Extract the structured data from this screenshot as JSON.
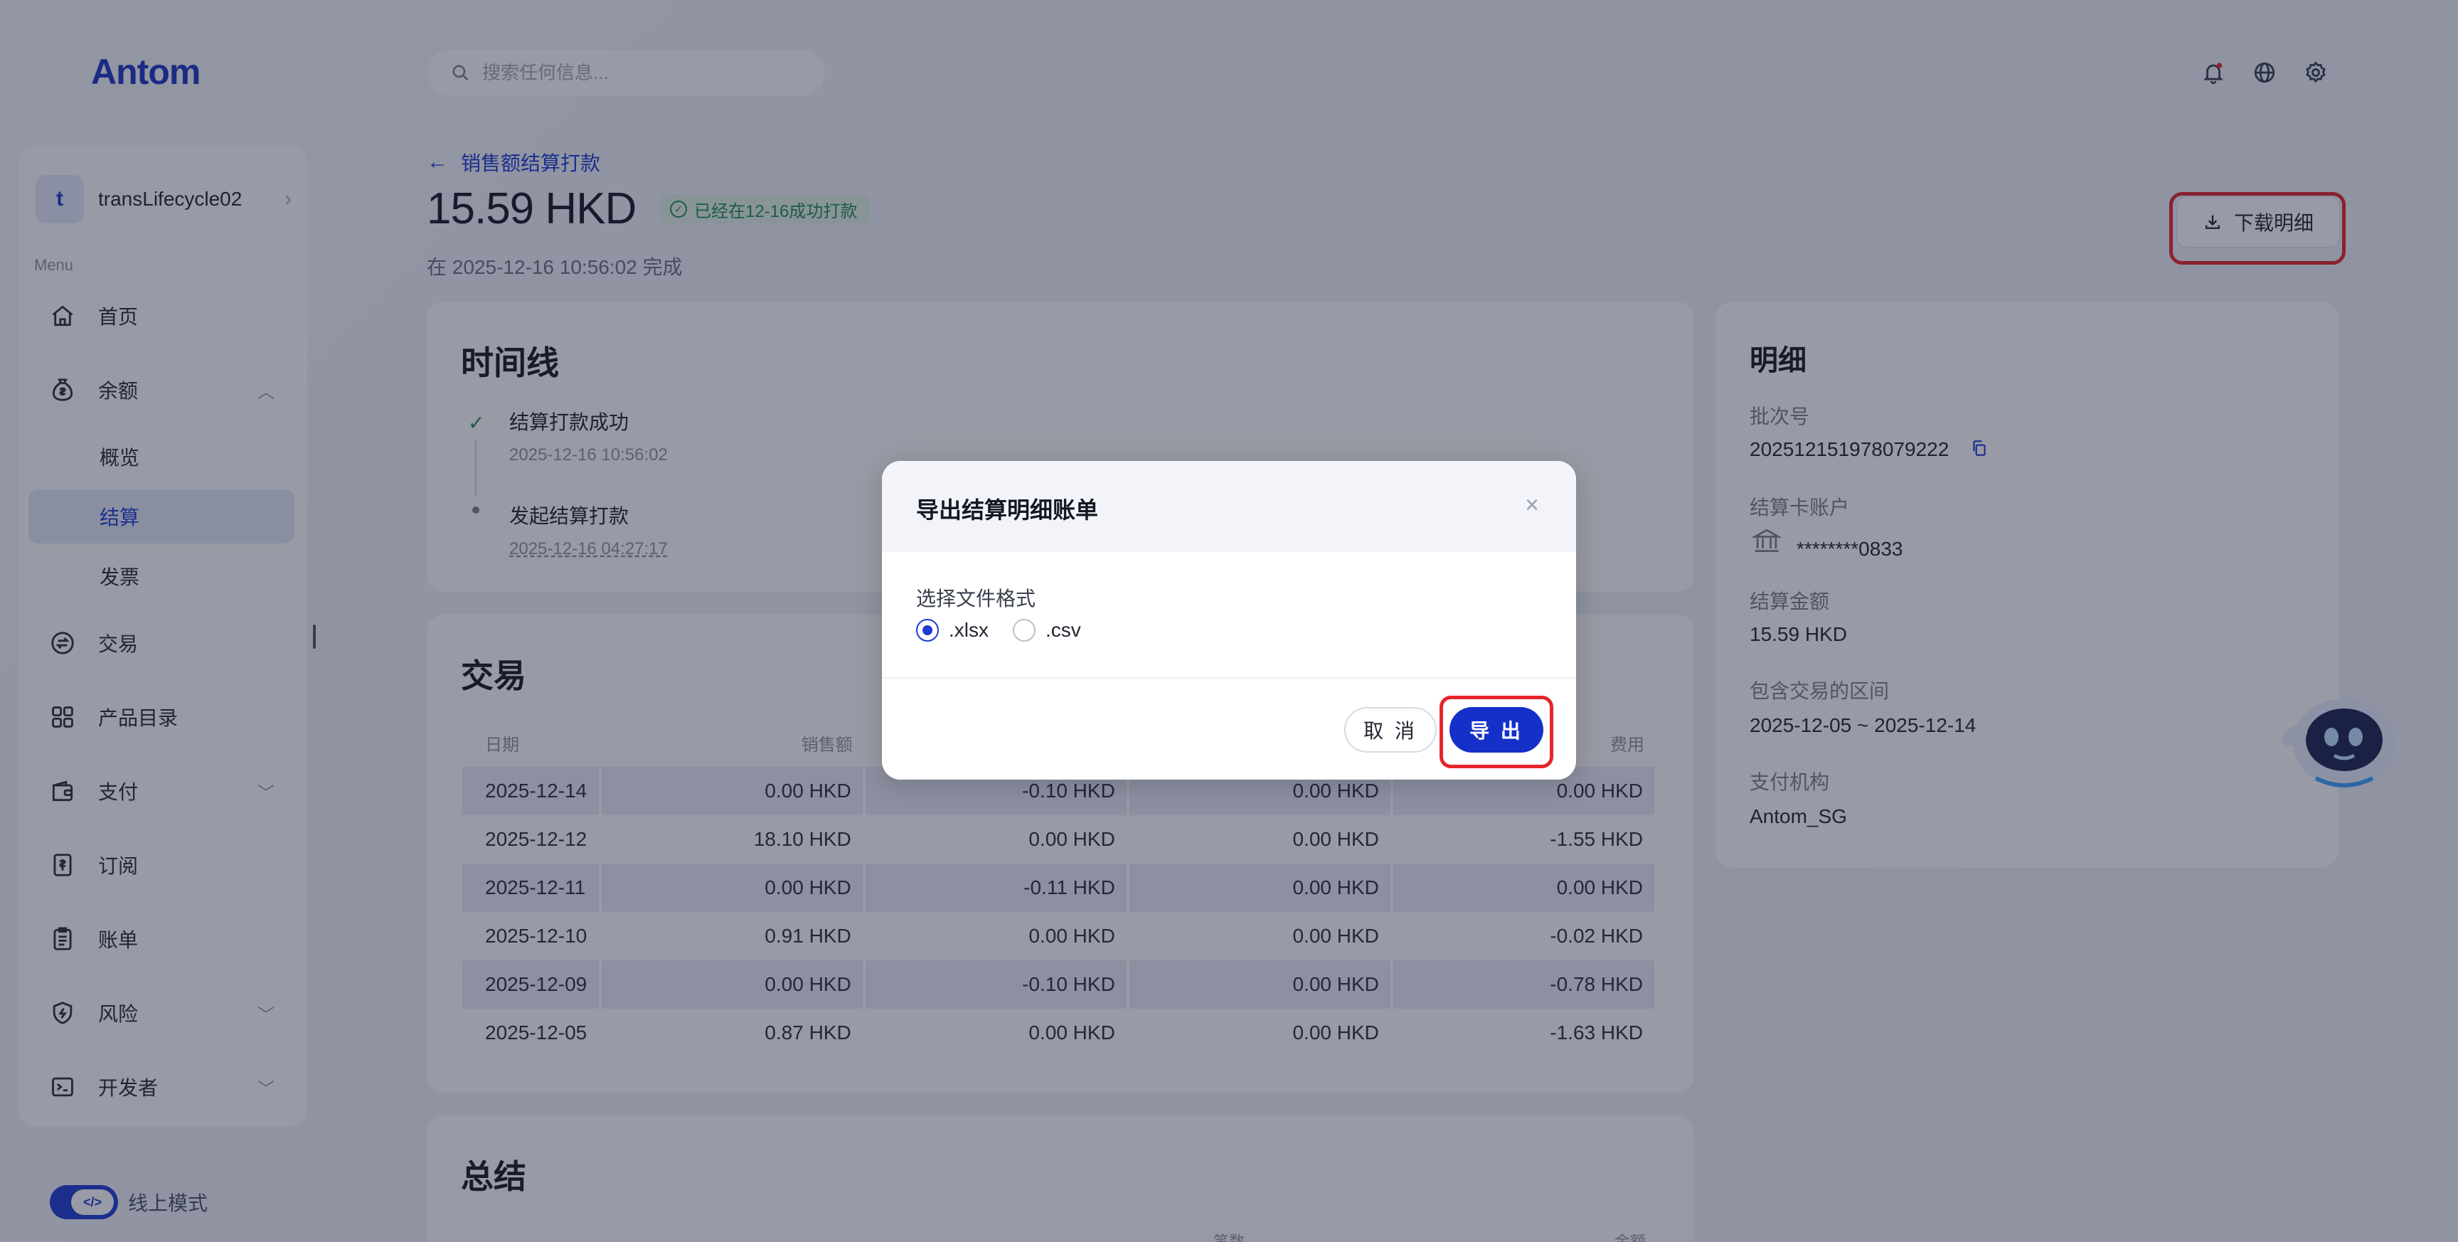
{
  "brand": {
    "logo_text": "Antom",
    "accent": "#1d3bd1"
  },
  "search": {
    "placeholder": "搜索任何信息..."
  },
  "account": {
    "initial": "t",
    "name": "transLifecycle02"
  },
  "sidebar": {
    "caption": "Menu",
    "items": [
      {
        "label": "首页",
        "icon": "home-icon"
      },
      {
        "label": "余额",
        "icon": "money-bag-icon",
        "expanded": true,
        "children": [
          {
            "label": "概览"
          },
          {
            "label": "结算",
            "active": true
          },
          {
            "label": "发票"
          }
        ]
      },
      {
        "label": "交易",
        "icon": "exchange-icon"
      },
      {
        "label": "产品目录",
        "icon": "grid-icon"
      },
      {
        "label": "支付",
        "icon": "wallet-icon"
      },
      {
        "label": "订阅",
        "icon": "subscription-icon"
      },
      {
        "label": "账单",
        "icon": "bill-icon"
      },
      {
        "label": "风险",
        "icon": "shield-icon"
      },
      {
        "label": "开发者",
        "icon": "terminal-icon"
      }
    ],
    "mode_label": "线上模式"
  },
  "header": {
    "back_label": "销售额结算打款",
    "amount": "15.59 HKD",
    "status": "已经在12-16成功打款",
    "completed": "在 2025-12-16 10:56:02 完成",
    "download_label": "下载明细"
  },
  "timeline": {
    "title": "时间线",
    "events": [
      {
        "title": "结算打款成功",
        "time": "2025-12-16 10:56:02"
      },
      {
        "title": "发起结算打款",
        "time": "2025-12-16 04:27:17"
      }
    ]
  },
  "transactions": {
    "title": "交易",
    "columns": [
      "日期",
      "销售额",
      "",
      "",
      "费用"
    ],
    "rows": [
      [
        "2025-12-14",
        "0.00 HKD",
        "-0.10 HKD",
        "0.00 HKD",
        "0.00 HKD"
      ],
      [
        "2025-12-12",
        "18.10 HKD",
        "0.00 HKD",
        "0.00 HKD",
        "-1.55 HKD"
      ],
      [
        "2025-12-11",
        "0.00 HKD",
        "-0.11 HKD",
        "0.00 HKD",
        "0.00 HKD"
      ],
      [
        "2025-12-10",
        "0.91 HKD",
        "0.00 HKD",
        "0.00 HKD",
        "-0.02 HKD"
      ],
      [
        "2025-12-09",
        "0.00 HKD",
        "-0.10 HKD",
        "0.00 HKD",
        "-0.78 HKD"
      ],
      [
        "2025-12-05",
        "0.87 HKD",
        "0.00 HKD",
        "0.00 HKD",
        "-1.63 HKD"
      ]
    ]
  },
  "summary": {
    "title": "总结",
    "col_count": "笔数",
    "col_amount": "金额"
  },
  "details": {
    "title": "明细",
    "batch_label": "批次号",
    "batch_value": "202512151978079222",
    "card_label": "结算卡账户",
    "card_value": "********0833",
    "amount_label": "结算金额",
    "amount_value": "15.59 HKD",
    "period_label": "包含交易的区间",
    "period_value": "2025-12-05 ~ 2025-12-14",
    "institution_label": "支付机构",
    "institution_value": "Antom_SG"
  },
  "modal": {
    "title": "导出结算明细账单",
    "format_label": "选择文件格式",
    "options": [
      {
        "label": ".xlsx",
        "selected": true
      },
      {
        "label": ".csv",
        "selected": false
      }
    ],
    "cancel_label": "取 消",
    "export_label": "导 出"
  },
  "colors": {
    "highlight": "#e5252a",
    "success": "#1d8f4b",
    "primary_button": "#1530c9"
  }
}
